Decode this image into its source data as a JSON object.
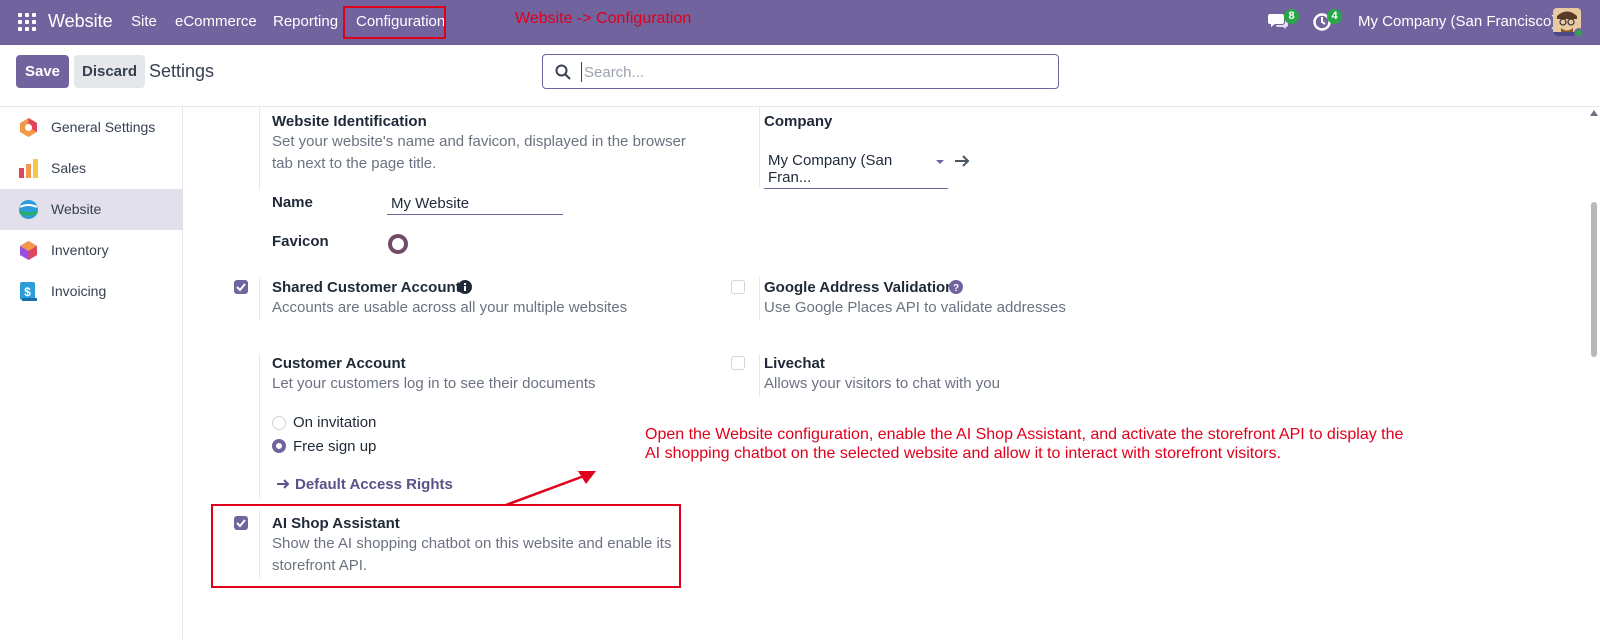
{
  "navbar": {
    "brand": "Website",
    "menu": [
      "Site",
      "eCommerce",
      "Reporting",
      "Configuration"
    ],
    "annotation": "Website -> Configuration",
    "messages_badge": "8",
    "activities_badge": "4",
    "company": "My Company (San Francisco)"
  },
  "control": {
    "save_label": "Save",
    "discard_label": "Discard",
    "title": "Settings",
    "search_placeholder": "Search..."
  },
  "sidebar": {
    "items": [
      {
        "label": "General Settings",
        "icon": "settings-app-icon"
      },
      {
        "label": "Sales",
        "icon": "sales-app-icon"
      },
      {
        "label": "Website",
        "icon": "website-app-icon"
      },
      {
        "label": "Inventory",
        "icon": "inventory-app-icon"
      },
      {
        "label": "Invoicing",
        "icon": "invoicing-app-icon"
      }
    ],
    "active": "Website"
  },
  "settings": {
    "website_identification": {
      "title": "Website Identification",
      "desc_line1": "Set your website's name and favicon, displayed in the browser",
      "desc_line2": "tab next to the page title.",
      "name_label": "Name",
      "name_value": "My Website",
      "favicon_label": "Favicon"
    },
    "company": {
      "title": "Company",
      "value": "My Company (San Fran..."
    },
    "shared_accounts": {
      "title": "Shared Customer Accounts",
      "desc": "Accounts are usable across all your multiple websites",
      "checked": true
    },
    "google_address": {
      "title": "Google Address Validation",
      "desc": "Use Google Places API to validate addresses",
      "checked": false
    },
    "customer_account": {
      "title": "Customer Account",
      "desc": "Let your customers log in to see their documents",
      "option_invitation": "On invitation",
      "option_signup": "Free sign up",
      "selected": "Free sign up",
      "link": "Default Access Rights"
    },
    "livechat": {
      "title": "Livechat",
      "desc": "Allows your visitors to chat with you",
      "checked": false
    },
    "ai_shop": {
      "title": "AI Shop Assistant",
      "desc_line1": "Show the AI shopping chatbot on this website and enable its",
      "desc_line2": "storefront API.",
      "checked": true
    }
  },
  "annotation": {
    "line1": "Open the Website configuration, enable the AI Shop Assistant, and activate the storefront API to display the",
    "line2": "AI shopping chatbot on the selected website and allow it to interact with storefront visitors."
  },
  "colors": {
    "brand": "#71639e",
    "annotation": "#e0001b",
    "badge": "#28a745"
  }
}
